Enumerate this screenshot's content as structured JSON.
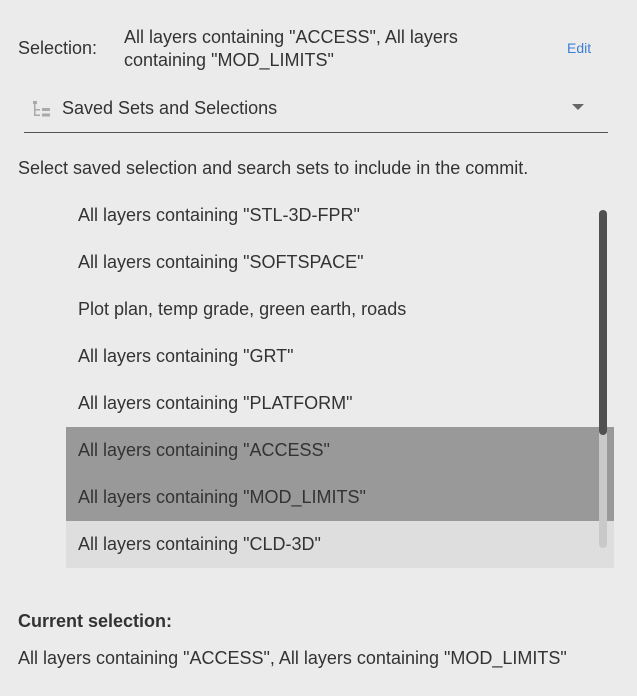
{
  "selection": {
    "label": "Selection:",
    "value": "All layers containing \"ACCESS\", All layers containing \"MOD_LIMITS\"",
    "edit_label": "Edit"
  },
  "dropdown": {
    "icon": "tree-list-icon",
    "selected": "Saved Sets and Selections"
  },
  "instructions": "Select saved selection and search sets to include in the commit.",
  "sets_list": {
    "items": [
      {
        "label": "All layers containing \"STL-3D-FPR\"",
        "state": "normal"
      },
      {
        "label": "All layers containing \"SOFTSPACE\"",
        "state": "normal"
      },
      {
        "label": "Plot plan, temp grade, green earth, roads",
        "state": "normal"
      },
      {
        "label": "All layers containing \"GRT\"",
        "state": "normal"
      },
      {
        "label": "All layers containing \"PLATFORM\"",
        "state": "normal"
      },
      {
        "label": "All layers containing \"ACCESS\"",
        "state": "selected"
      },
      {
        "label": "All layers containing \"MOD_LIMITS\"",
        "state": "selected"
      },
      {
        "label": "All layers containing \"CLD-3D\"",
        "state": "hover"
      }
    ]
  },
  "current_selection": {
    "title": "Current selection:",
    "value": "All layers containing \"ACCESS\", All layers containing \"MOD_LIMITS\""
  },
  "colors": {
    "background": "#ebebeb",
    "selected_row": "#999999",
    "hover_row": "#dedede",
    "link": "#3d7fd6"
  }
}
